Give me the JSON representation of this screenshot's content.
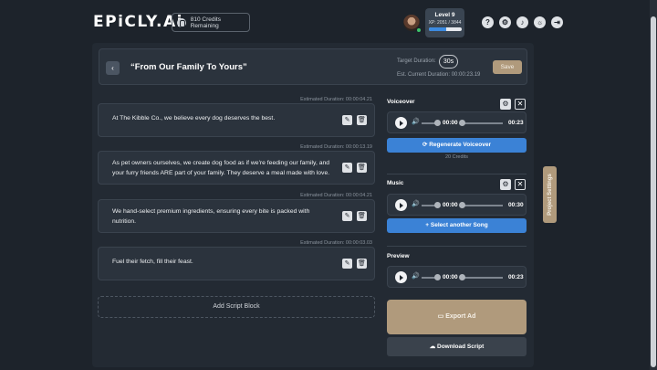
{
  "header": {
    "logo": "EPiCLY.Ai",
    "credits": "810 Credits Remaining",
    "level": "Level 9",
    "xp": "XP: 2051 / 3844",
    "xp_progress": 0.53
  },
  "project": {
    "title": "“From Our Family To Yours”",
    "target_label": "Target Duration:",
    "target_value": "30s",
    "est_current": "Est. Current Duration: 00:00:23.19",
    "save_label": "Save"
  },
  "script_blocks": [
    {
      "est": "Estimated Duration: 00:00:04.21",
      "text": "At The Kibble Co., we believe every dog deserves the best."
    },
    {
      "est": "Estimated Duration: 00:00:13.19",
      "text": "As pet owners ourselves, we create dog food as if we're feeding our family, and your furry friends ARE part of your family. They deserve a meal made with love."
    },
    {
      "est": "Estimated Duration: 00:00:04.21",
      "text": "We hand-select premium ingredients, ensuring every bite is packed with nutrition."
    },
    {
      "est": "Estimated Duration: 00:00:03.03",
      "text": "Fuel their fetch, fill their feast."
    }
  ],
  "add_block_label": "Add Script Block",
  "voiceover": {
    "title": "Voiceover",
    "current": "00:00",
    "total": "00:23",
    "regen_label": "Regenerate Voiceover",
    "credits_note": "20 Credits"
  },
  "music": {
    "title": "Music",
    "current": "00:00",
    "total": "00:30",
    "select_label": "Select another Song"
  },
  "preview": {
    "title": "Preview",
    "current": "00:00",
    "total": "00:23"
  },
  "export_label": "Export Ad",
  "download_label": "Download Script",
  "project_settings_label": "Project Settings"
}
